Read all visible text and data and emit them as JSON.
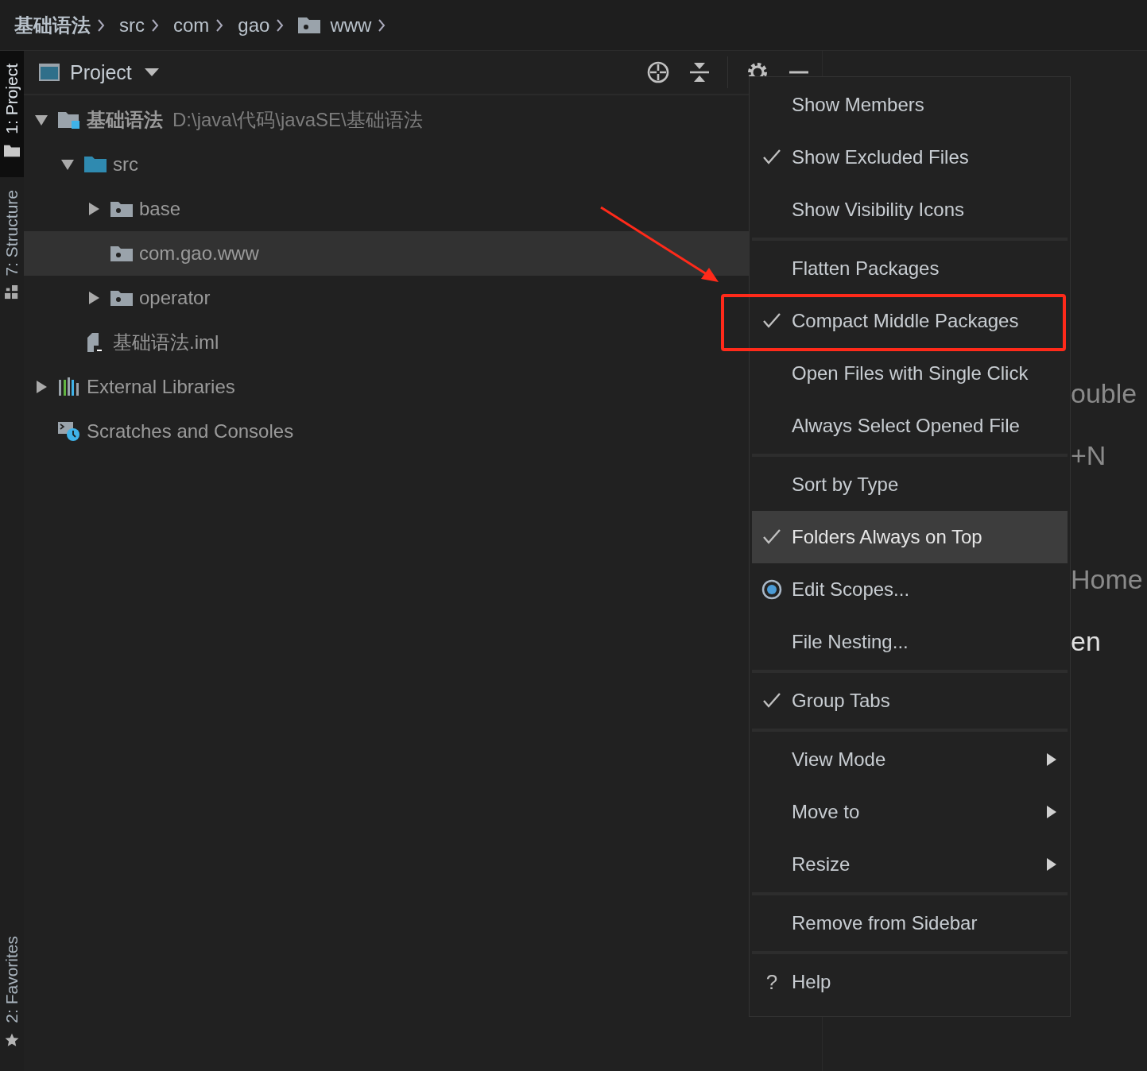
{
  "breadcrumb": [
    {
      "label": "基础语法",
      "kind": "module"
    },
    {
      "label": "src",
      "kind": "plain"
    },
    {
      "label": "com",
      "kind": "plain"
    },
    {
      "label": "gao",
      "kind": "plain"
    },
    {
      "label": "www",
      "kind": "package"
    }
  ],
  "tool_tabs": [
    {
      "label": "1: Project",
      "kind": "project",
      "selected": true
    },
    {
      "label": "7: Structure",
      "kind": "structure",
      "selected": false
    },
    {
      "label": "2: Favorites",
      "kind": "favorites",
      "selected": false
    }
  ],
  "panel": {
    "title": "Project"
  },
  "tree": [
    {
      "label": "基础语法",
      "detail": "D:\\java\\代码\\javaSE\\基础语法",
      "kind": "module",
      "expanded": true,
      "selected": false,
      "children": [
        {
          "label": "src",
          "kind": "source-folder",
          "expanded": true,
          "selected": false,
          "children": [
            {
              "label": "base",
              "kind": "package",
              "expanded": false,
              "selected": false
            },
            {
              "label": "com.gao.www",
              "kind": "package",
              "selected": true
            },
            {
              "label": "operator",
              "kind": "package",
              "expanded": false,
              "selected": false
            }
          ]
        },
        {
          "label": "基础语法.iml",
          "kind": "iml-file",
          "selected": false
        }
      ]
    },
    {
      "label": "External Libraries",
      "kind": "libraries",
      "expanded": false,
      "selected": false
    },
    {
      "label": "Scratches and Consoles",
      "kind": "scratches",
      "selected": false
    }
  ],
  "menu": {
    "groups": [
      {
        "items": [
          {
            "label": "Show Members",
            "kind": "toggle",
            "checked": false,
            "selected": false
          },
          {
            "label": "Show Excluded Files",
            "kind": "toggle",
            "checked": true,
            "selected": false
          },
          {
            "label": "Show Visibility Icons",
            "kind": "toggle",
            "checked": false,
            "selected": false
          }
        ]
      },
      {
        "items": [
          {
            "label": "Flatten Packages",
            "kind": "toggle",
            "checked": false,
            "selected": false
          },
          {
            "label": "Compact Middle Packages",
            "kind": "toggle",
            "checked": true,
            "selected": false
          },
          {
            "label": "Open Files with Single Click",
            "kind": "toggle",
            "checked": false,
            "selected": false
          },
          {
            "label": "Always Select Opened File",
            "kind": "toggle",
            "checked": false,
            "selected": false
          }
        ]
      },
      {
        "items": [
          {
            "label": "Sort by Type",
            "kind": "toggle",
            "checked": false,
            "selected": false
          },
          {
            "label": "Folders Always on Top",
            "kind": "toggle",
            "checked": true,
            "selected": true
          },
          {
            "label": "Edit Scopes...",
            "kind": "scopes",
            "selected": false
          },
          {
            "label": "File Nesting...",
            "kind": "action",
            "selected": false
          }
        ]
      },
      {
        "items": [
          {
            "label": "Group Tabs",
            "kind": "toggle",
            "checked": true,
            "selected": false
          }
        ]
      },
      {
        "items": [
          {
            "label": "View Mode",
            "kind": "submenu",
            "selected": false
          },
          {
            "label": "Move to",
            "kind": "submenu",
            "selected": false
          },
          {
            "label": "Resize",
            "kind": "submenu",
            "selected": false
          }
        ]
      },
      {
        "items": [
          {
            "label": "Remove from Sidebar",
            "kind": "action",
            "selected": false
          }
        ]
      },
      {
        "items": [
          {
            "label": "Help",
            "kind": "help",
            "glyph": "?",
            "selected": false
          }
        ]
      }
    ]
  },
  "editor_hints": [
    "ouble",
    "+N",
    "Home",
    "en"
  ],
  "annotations": {
    "arrow": true,
    "frame": true
  }
}
